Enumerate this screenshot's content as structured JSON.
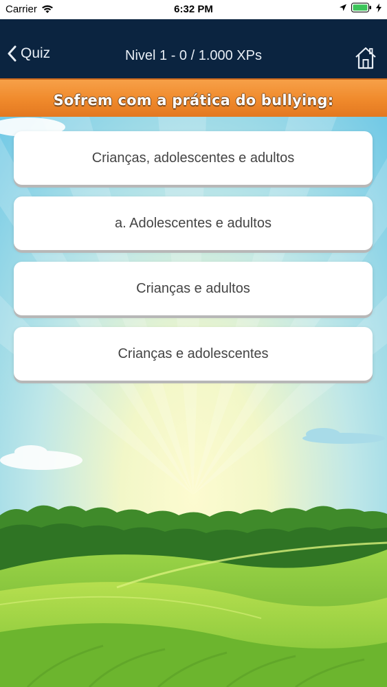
{
  "status_bar": {
    "carrier": "Carrier",
    "time": "6:32 PM",
    "icons": [
      "wifi-icon",
      "location-arrow-icon",
      "battery-icon",
      "charging-bolt-icon"
    ]
  },
  "nav": {
    "back_label": "Quiz",
    "title": "Nivel 1 - 0 / 1.000 XPs",
    "home_icon": "home-icon"
  },
  "question": {
    "text": "Sofrem com a prática do bullying:"
  },
  "options": [
    {
      "label": "Crianças, adolescentes e adultos"
    },
    {
      "label": "a. Adolescentes e adultos"
    },
    {
      "label": "Crianças e adultos"
    },
    {
      "label": "Crianças e adolescentes"
    }
  ],
  "colors": {
    "nav_bg": "#0b2440",
    "banner": "#f08a2c",
    "sky_top": "#7fd0ea",
    "sun_glow": "#fbf7b8",
    "grass": "#7cc83a"
  }
}
